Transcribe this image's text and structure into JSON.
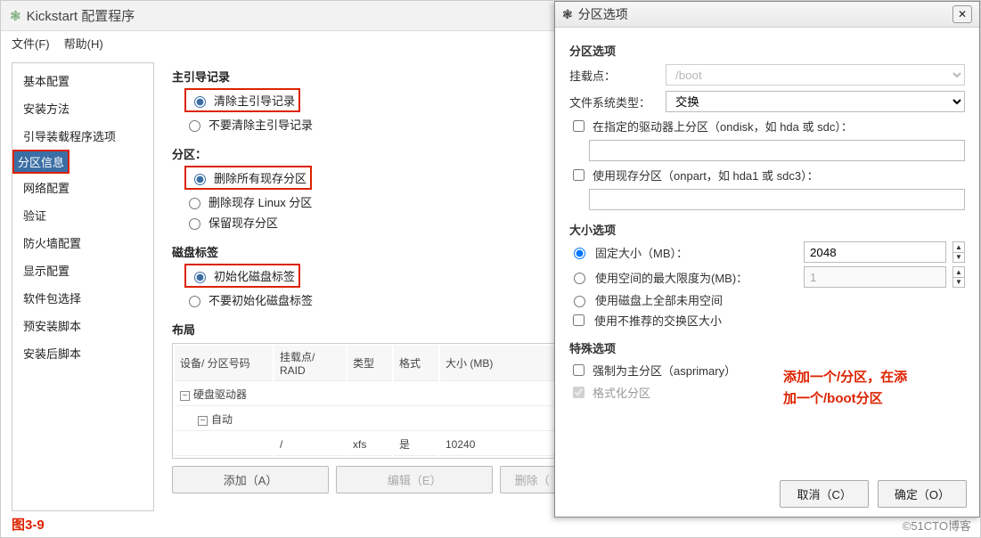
{
  "window": {
    "title": "Kickstart 配置程序"
  },
  "menu": {
    "file": "文件(F)",
    "help": "帮助(H)"
  },
  "sidebar": {
    "items": [
      "基本配置",
      "安装方法",
      "引导装载程序选项",
      "分区信息",
      "网络配置",
      "验证",
      "防火墙配置",
      "显示配置",
      "软件包选择",
      "预安装脚本",
      "安装后脚本"
    ],
    "selected_index": 3
  },
  "sections": {
    "mbr_title": "主引导记录",
    "mbr_clear": "清除主引导记录",
    "mbr_keep": "不要清除主引导记录",
    "part_title": "分区：",
    "part_remove_all": "删除所有现存分区",
    "part_remove_linux": "删除现存 Linux 分区",
    "part_keep": "保留现存分区",
    "disk_title": "磁盘标签",
    "disk_init": "初始化磁盘标签",
    "disk_noinit": "不要初始化磁盘标签",
    "layout_title": "布局"
  },
  "table": {
    "headers": {
      "dev": "设备/\n分区号码",
      "mount": "挂载点/\nRAID",
      "type": "类型",
      "fmt": "格式",
      "size": "大小 (MB)"
    },
    "rows": {
      "group": "硬盘驱动器",
      "auto": "自动",
      "mount": "/",
      "type": "xfs",
      "fmt": "是",
      "size": "10240"
    }
  },
  "buttons": {
    "add": "添加（A）",
    "edit": "编辑（E）",
    "delete": "删除（"
  },
  "figure": "图3-9",
  "watermark": "©51CTO博客",
  "dialog": {
    "title": "分区选项",
    "section1": "分区选项",
    "mount_label": "挂载点：",
    "mount_value": "/boot",
    "fstype_label": "文件系统类型：",
    "fstype_value": "交换",
    "ondisk_chk": "在指定的驱动器上分区（ondisk，如 hda 或 sdc）：",
    "ondisk_value": "",
    "onpart_chk": "使用现存分区（onpart，如 hda1 或 sdc3）：",
    "onpart_value": "",
    "size_section": "大小选项",
    "size_fixed": "固定大小（MB）：",
    "size_fixed_val": "2048",
    "size_max": "使用空间的最大限度为(MB)：",
    "size_max_val": "1",
    "size_fill": "使用磁盘上全部未用空间",
    "size_rec": "使用不推荐的交换区大小",
    "special_section": "特殊选项",
    "asprimary": "强制为主分区（asprimary）",
    "format": "格式化分区",
    "note_l1": "添加一个/分区，在添",
    "note_l2": "加一个/boot分区",
    "cancel": "取消（C）",
    "ok": "确定（O）"
  }
}
